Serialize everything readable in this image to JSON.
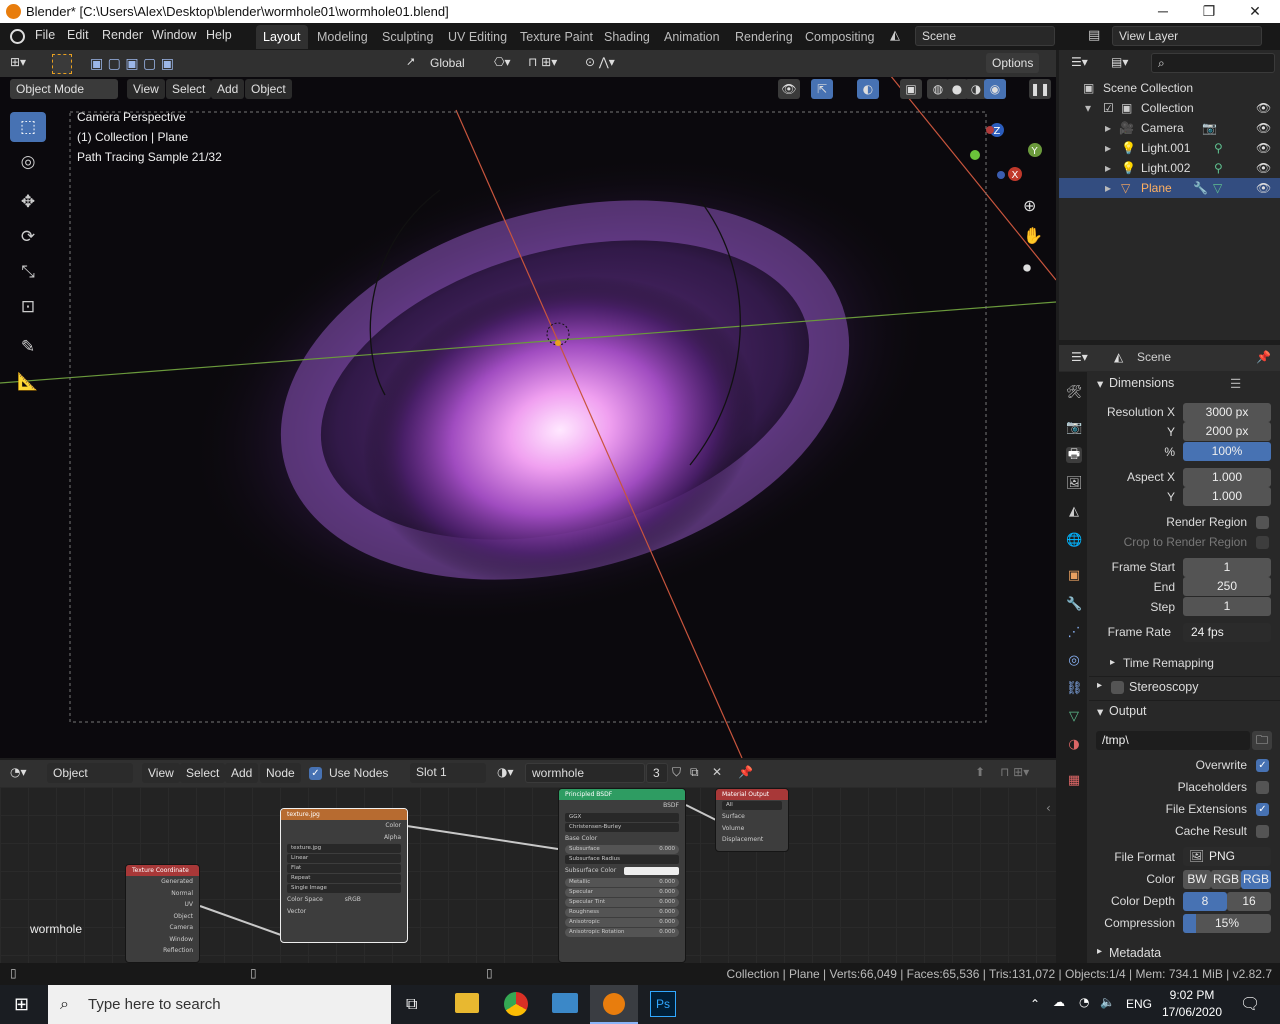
{
  "window": {
    "title": "Blender* [C:\\Users\\Alex\\Desktop\\blender\\wormhole01\\wormhole01.blend]",
    "minimize": "─",
    "maximize": "❐",
    "close": "✕"
  },
  "topbar": {
    "menus": [
      "File",
      "Edit",
      "Render",
      "Window",
      "Help"
    ],
    "workspaces": [
      "Layout",
      "Modeling",
      "Sculpting",
      "UV Editing",
      "Texture Paint",
      "Shading",
      "Animation",
      "Rendering",
      "Compositing"
    ],
    "active_workspace": "Layout",
    "scene": "Scene",
    "view_layer": "View Layer"
  },
  "viewport_header": {
    "transform_orientation": "Global",
    "options": "Options",
    "mode": "Object Mode",
    "menus": [
      "View",
      "Select",
      "Add",
      "Object"
    ]
  },
  "viewport": {
    "overlay": [
      "Camera Perspective",
      "(1) Collection | Plane",
      "Path Tracing Sample 21/32"
    ],
    "gizmo": {
      "z": "Z",
      "y": "Y",
      "x": "X"
    }
  },
  "node_editor": {
    "type": "Object",
    "menus": [
      "View",
      "Select",
      "Add",
      "Node"
    ],
    "use_nodes": "Use Nodes",
    "slot": "Slot 1",
    "material": "wormhole",
    "users": "3",
    "label": "wormhole",
    "nodes": {
      "texcoord": {
        "title": "Texture Coordinate",
        "outputs": [
          "Generated",
          "Normal",
          "UV",
          "Object",
          "Camera",
          "Window",
          "Reflection"
        ]
      },
      "image": {
        "title": "texture.jpg",
        "outputs": [
          "Color",
          "Alpha"
        ],
        "image": "texture.jpg",
        "dropdowns": [
          "Linear",
          "Flat",
          "Repeat",
          "Single Image"
        ],
        "colorspace_label": "Color Space",
        "colorspace": "sRGB",
        "input": "Vector"
      },
      "bsdf": {
        "title": "Principled BSDF",
        "output": "BSDF",
        "dropdowns": [
          "GGX",
          "Christensen-Burley"
        ],
        "base_color": "Base Color",
        "sliders": [
          {
            "label": "Subsurface",
            "value": "0.000"
          }
        ],
        "subsurface_radius": "Subsurface Radius",
        "subsurface_color": "Subsurface Color",
        "params": [
          {
            "label": "Metallic",
            "value": "0.000"
          },
          {
            "label": "Specular",
            "value": "0.000"
          },
          {
            "label": "Specular Tint",
            "value": "0.000"
          },
          {
            "label": "Roughness",
            "value": "0.000"
          },
          {
            "label": "Anisotropic",
            "value": "0.000"
          },
          {
            "label": "Anisotropic Rotation",
            "value": "0.000"
          }
        ]
      },
      "output": {
        "title": "Material Output",
        "target": "All",
        "inputs": [
          "Surface",
          "Volume",
          "Displacement"
        ]
      }
    }
  },
  "outliner": {
    "root": "Scene Collection",
    "collection": "Collection",
    "items": [
      "Camera",
      "Light.001",
      "Light.002",
      "Plane"
    ],
    "selected": "Plane"
  },
  "properties": {
    "context": "Scene",
    "dimensions": {
      "header": "Dimensions",
      "resolution_x_label": "Resolution X",
      "resolution_x": "3000 px",
      "y_label": "Y",
      "resolution_y": "2000 px",
      "pct_label": "%",
      "percentage": "100%",
      "aspect_x_label": "Aspect X",
      "aspect_x": "1.000",
      "aspect_y": "1.000",
      "render_region": "Render Region",
      "crop": "Crop to Render Region",
      "frame_start_label": "Frame Start",
      "frame_start": "1",
      "end_label": "End",
      "frame_end": "250",
      "step_label": "Step",
      "frame_step": "1",
      "frame_rate_label": "Frame Rate",
      "frame_rate": "24 fps",
      "time_remapping": "Time Remapping"
    },
    "stereoscopy": "Stereoscopy",
    "output": {
      "header": "Output",
      "path": "/tmp\\",
      "overwrite": "Overwrite",
      "placeholders": "Placeholders",
      "file_extensions": "File Extensions",
      "cache_result": "Cache Result",
      "file_format_label": "File Format",
      "file_format": "PNG",
      "color_label": "Color",
      "color_modes": [
        "BW",
        "RGB",
        "RGB"
      ],
      "color_depth_label": "Color Depth",
      "color_depths": [
        "8",
        "16"
      ],
      "compression_label": "Compression",
      "compression": "15%"
    },
    "metadata": "Metadata"
  },
  "status": {
    "text": "Collection | Plane | Verts:66,049 | Faces:65,536 | Tris:131,072 | Objects:1/4 | Mem: 734.1 MiB | v2.82.7"
  },
  "taskbar": {
    "search_placeholder": "Type here to search",
    "lang": "ENG",
    "time": "9:02 PM",
    "date": "17/06/2020"
  },
  "colors": {
    "accent": "#4772b3",
    "header": "#303030",
    "panel": "#282828"
  }
}
